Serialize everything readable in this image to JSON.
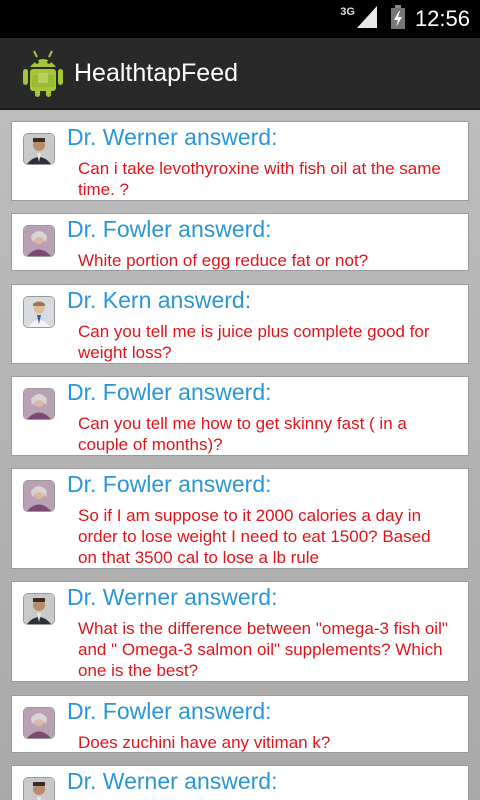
{
  "status_bar": {
    "network": "3G",
    "time": "12:56"
  },
  "action_bar": {
    "app_icon": "android-icon",
    "title": "HealthtapFeed"
  },
  "feed": {
    "items": [
      {
        "doctor": "Dr. Werner answerd:",
        "avatar": "doctor-werner",
        "question": "Can i take levothyroxine with fish oil at the same time. ?"
      },
      {
        "doctor": "Dr. Fowler answerd:",
        "avatar": "doctor-fowler",
        "question": "White portion of egg reduce fat or not?"
      },
      {
        "doctor": "Dr. Kern answerd:",
        "avatar": "doctor-kern",
        "question": "Can you tell me is juice plus complete good for weight loss?"
      },
      {
        "doctor": "Dr. Fowler answerd:",
        "avatar": "doctor-fowler",
        "question": "Can you tell me how to get skinny fast ( in a couple of months)?"
      },
      {
        "doctor": "Dr. Fowler answerd:",
        "avatar": "doctor-fowler",
        "question": "So if I am suppose to it 2000 calories a day in order to lose weight I need to eat 1500? Based on that 3500 cal to lose a lb rule"
      },
      {
        "doctor": "Dr. Werner answerd:",
        "avatar": "doctor-werner",
        "question": "What is the difference between \"omega-3 fish oil\"  and \" Omega-3 salmon oil\" supplements? Which one is the best?"
      },
      {
        "doctor": "Dr. Fowler answerd:",
        "avatar": "doctor-fowler",
        "question": "Does zuchini have any vitiman k?"
      },
      {
        "doctor": "Dr. Werner answerd:",
        "avatar": "doctor-werner",
        "question": ""
      }
    ]
  },
  "colors": {
    "doctor_name": "#2a96d4",
    "question": "#e0141a",
    "action_bar": "#292929",
    "status_bar": "#000000"
  }
}
